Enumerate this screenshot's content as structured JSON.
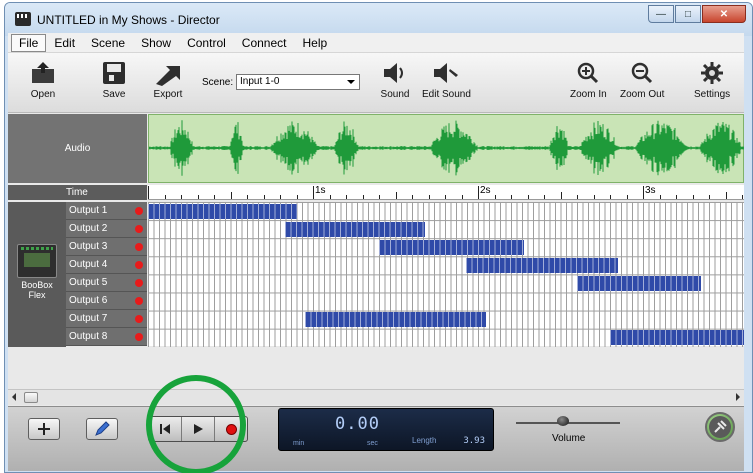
{
  "window": {
    "title": "UNTITLED in My Shows - Director"
  },
  "menu": [
    "File",
    "Edit",
    "Scene",
    "Show",
    "Control",
    "Connect",
    "Help"
  ],
  "toolbar": {
    "open": "Open",
    "save": "Save",
    "export": "Export",
    "scene_label": "Scene:",
    "scene_value": "Input 1-0",
    "sound": "Sound",
    "edit_sound": "Edit Sound",
    "zoom_in": "Zoom In",
    "zoom_out": "Zoom Out",
    "settings": "Settings"
  },
  "timeline": {
    "audio_label": "Audio",
    "time_label": "Time",
    "tick_labels": [
      "1s",
      "2s",
      "3s"
    ],
    "device": {
      "name_line1": "BooBox",
      "name_line2": "Flex"
    },
    "outputs": [
      "Output 1",
      "Output 2",
      "Output 3",
      "Output 4",
      "Output 5",
      "Output 6",
      "Output 7",
      "Output 8"
    ]
  },
  "cues": [
    {
      "output": "Output 1",
      "start_s": 0.0,
      "end_s": 0.9
    },
    {
      "output": "Output 2",
      "start_s": 0.83,
      "end_s": 1.68
    },
    {
      "output": "Output 3",
      "start_s": 1.4,
      "end_s": 2.28
    },
    {
      "output": "Output 4",
      "start_s": 1.93,
      "end_s": 2.85
    },
    {
      "output": "Output 5",
      "start_s": 2.6,
      "end_s": 3.35
    },
    {
      "output": "Output 7",
      "start_s": 0.95,
      "end_s": 2.05
    },
    {
      "output": "Output 8",
      "start_s": 2.8,
      "end_s": 3.7
    }
  ],
  "transport": {
    "time": "0.00",
    "min_label": "min",
    "sec_label": "sec",
    "length_label": "Length",
    "length_value": "3.93",
    "volume_label": "Volume",
    "volume_level": 0.45
  },
  "colors": {
    "cue_bar": "#2f4aa8",
    "waveform": "#1f9a3a",
    "highlight": "#17a33b",
    "record": "#e01010"
  }
}
